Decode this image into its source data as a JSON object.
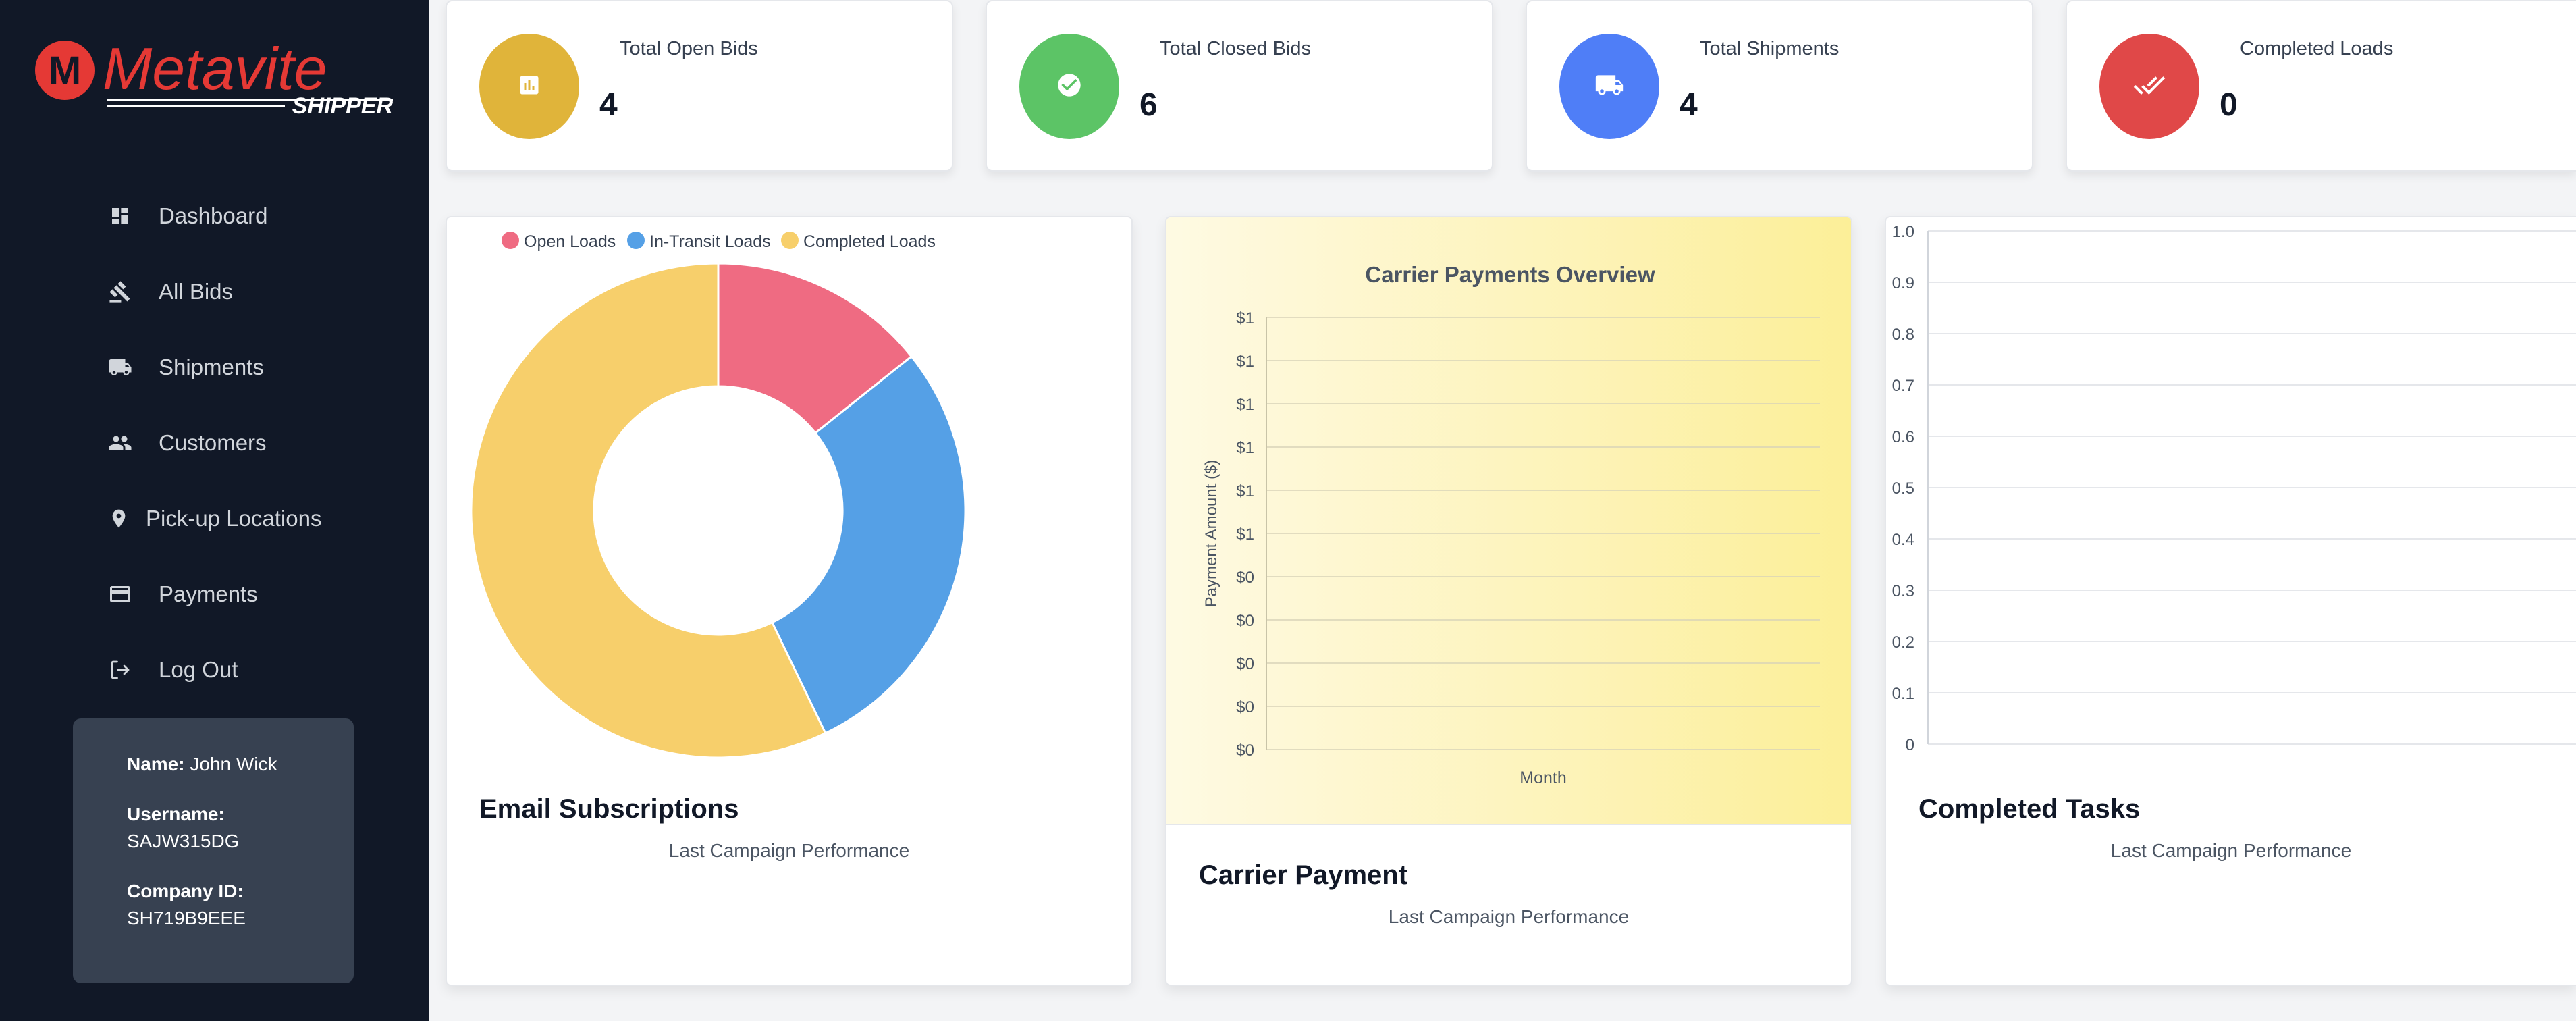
{
  "app": {
    "brand_main": "Metavite",
    "brand_sub": "SHIPPER",
    "brand_letter": "M",
    "colors": {
      "sidebar_bg": "#111827",
      "brand_red": "#e53935",
      "accent_blue": "#4f7ef7"
    }
  },
  "sidebar": {
    "items": [
      {
        "label": "Dashboard",
        "icon": "dashboard-icon"
      },
      {
        "label": "All Bids",
        "icon": "gavel-icon"
      },
      {
        "label": "Shipments",
        "icon": "truck-icon"
      },
      {
        "label": "Customers",
        "icon": "people-icon"
      },
      {
        "label": "Pick-up Locations",
        "icon": "location-pin-icon"
      },
      {
        "label": "Payments",
        "icon": "credit-card-icon"
      },
      {
        "label": "Log Out",
        "icon": "logout-icon"
      }
    ],
    "user": {
      "name_label": "Name:",
      "name": "John Wick",
      "username_label": "Username:",
      "username": "SAJW315DG",
      "company_label": "Company ID:",
      "company_id": "SH719B9EEE"
    }
  },
  "stats": [
    {
      "label": "Total Open Bids",
      "value": "4",
      "color": "#e0b43a",
      "icon": "bar-chart-icon"
    },
    {
      "label": "Total Closed Bids",
      "value": "6",
      "color": "#5cc466",
      "icon": "check-circle-icon"
    },
    {
      "label": "Total Shipments",
      "value": "4",
      "color": "#4f7ef7",
      "icon": "truck-icon"
    },
    {
      "label": "Completed Loads",
      "value": "0",
      "color": "#e04848",
      "icon": "double-check-icon"
    }
  ],
  "cards": {
    "email": {
      "title": "Email Subscriptions",
      "subtitle": "Last Campaign Performance"
    },
    "carrier": {
      "title": "Carrier Payment",
      "subtitle": "Last Campaign Performance"
    },
    "tasks": {
      "title": "Completed Tasks",
      "subtitle": "Last Campaign Performance"
    }
  },
  "chart_data": [
    {
      "type": "pie",
      "variant": "doughnut",
      "legend_position": "top",
      "categories": [
        "Open Loads",
        "In-Transit Loads",
        "Completed Loads"
      ],
      "values": [
        1,
        2,
        4
      ],
      "colors": [
        "#ef6b82",
        "#55a0e6",
        "#f7cf6b"
      ]
    },
    {
      "type": "line",
      "title": "Carrier Payments Overview",
      "xlabel": "Month",
      "ylabel": "Payment Amount ($)",
      "y_tick_labels": [
        "$1",
        "$1",
        "$1",
        "$1",
        "$1",
        "$1",
        "$0",
        "$0",
        "$0",
        "$0",
        "$0"
      ],
      "series": [],
      "grid": true
    },
    {
      "type": "bar",
      "ylim": [
        0,
        1.0
      ],
      "y_tick_labels": [
        "1.0",
        "0.9",
        "0.8",
        "0.7",
        "0.6",
        "0.5",
        "0.4",
        "0.3",
        "0.2",
        "0.1",
        "0"
      ],
      "series": [],
      "grid": true
    }
  ]
}
